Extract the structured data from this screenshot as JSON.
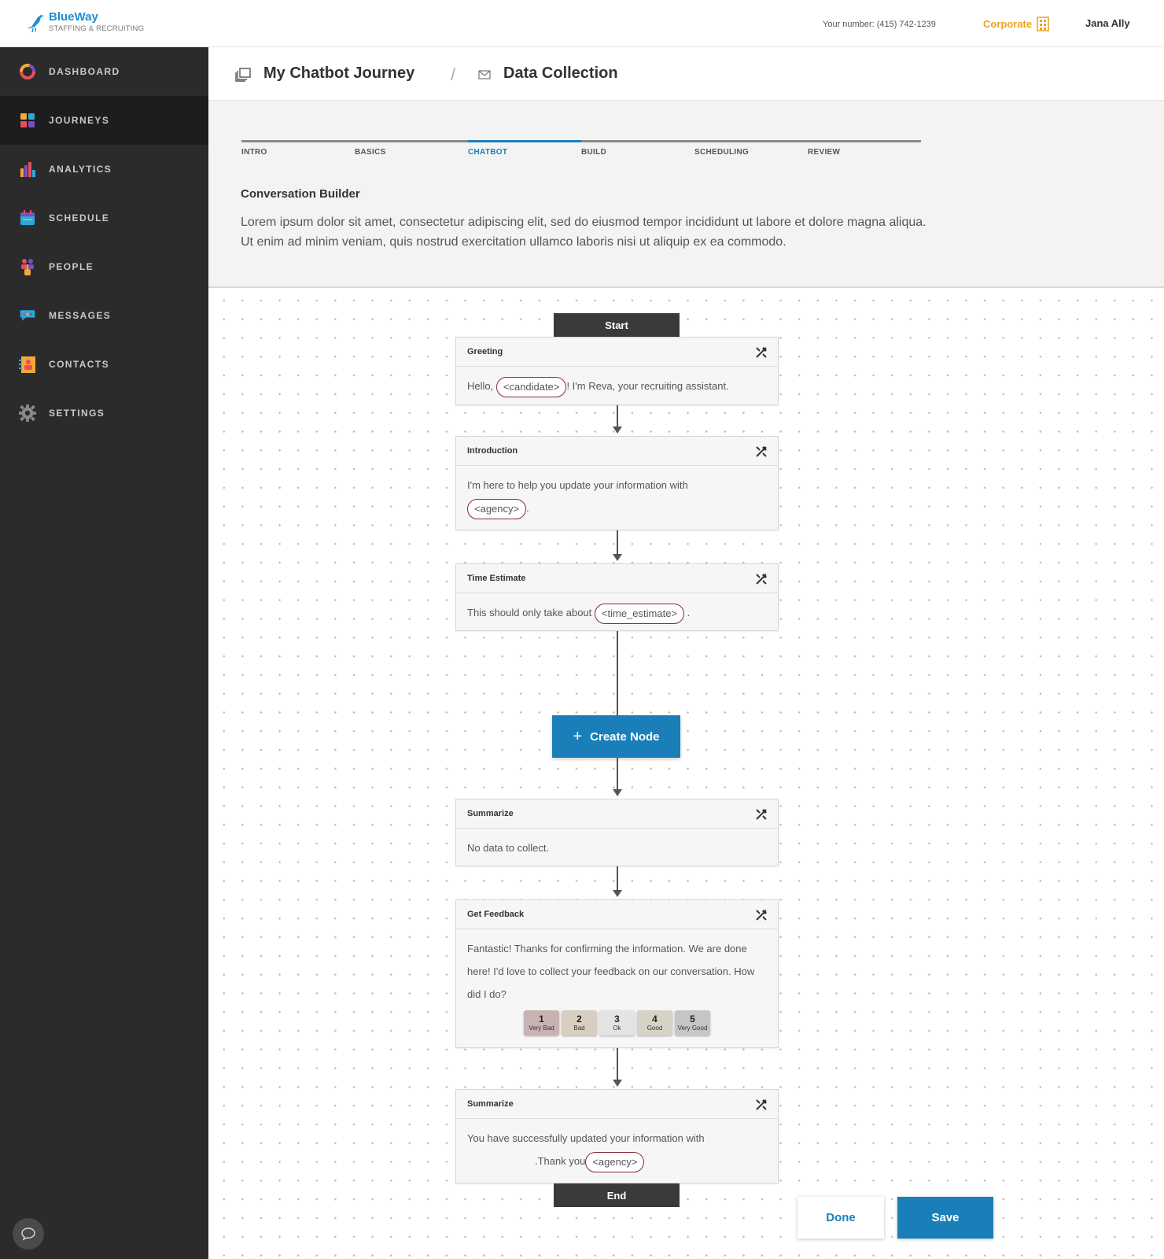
{
  "header": {
    "brand_name": "BlueWay",
    "brand_tagline": "STAFFING & RECRUITING",
    "phone": "Your number: (415) 742-1239",
    "account": "Corporate",
    "user": "Jana Ally",
    "colors": {
      "brand": "#1b8fd6",
      "account": "#f0a21c"
    }
  },
  "sidebar": {
    "items": [
      {
        "label": "DASHBOARD",
        "icon": "dashboard-ring-icon"
      },
      {
        "label": "JOURNEYS",
        "icon": "journeys-grid-icon",
        "active": true
      },
      {
        "label": "ANALYTICS",
        "icon": "analytics-bar-icon"
      },
      {
        "label": "SCHEDULE",
        "icon": "calendar-icon"
      },
      {
        "label": "PEOPLE",
        "icon": "people-icon"
      },
      {
        "label": "MESSAGES",
        "icon": "message-bubble-icon"
      },
      {
        "label": "CONTACTS",
        "icon": "contact-card-icon"
      },
      {
        "label": "SETTINGS",
        "icon": "gear-icon"
      }
    ]
  },
  "breadcrumb": {
    "journey": "My Chatbot Journey",
    "separator": "/",
    "page": "Data Collection"
  },
  "steps": [
    {
      "label": "INTRO"
    },
    {
      "label": "BASICS"
    },
    {
      "label": "CHATBOT",
      "active": true
    },
    {
      "label": "BUILD"
    },
    {
      "label": "SCHEDULING"
    },
    {
      "label": "REVIEW"
    }
  ],
  "builder": {
    "title": "Conversation Builder",
    "description": "Lorem ipsum dolor sit amet, consectetur adipiscing elit, sed do eiusmod tempor incididunt ut labore et dolore magna aliqua. Ut enim ad minim veniam, quis nostrud exercitation ullamco laboris nisi ut aliquip ex ea commodo."
  },
  "flow": {
    "start_label": "Start",
    "end_label": "End",
    "create_node_label": "Create Node",
    "nodes": [
      {
        "title": "Greeting",
        "text_before": "Hello,",
        "chip": "<candidate>",
        "text_after": "! I'm Reva, your recruiting assistant."
      },
      {
        "title": "Introduction",
        "text_before": "I'm here to help you update your information with",
        "chip": "<agency>",
        "text_after": "."
      },
      {
        "title": "Time Estimate",
        "text_before": "This should only take about",
        "chip": "<time_estimate>",
        "text_after": "."
      },
      {
        "title": "Summarize",
        "text_before": "No data to collect."
      },
      {
        "title": "Get Feedback",
        "text_before": "Fantastic! Thanks for confirming the information. We are done here! I'd love to collect your feedback on our conversation. How did I do?"
      },
      {
        "title": "Summarize",
        "text_before": "You have successfully updated your information with",
        "text_mid": ".Thank you",
        "chip": "<agency>"
      }
    ],
    "ratings": [
      {
        "num": "1",
        "label": "Very Bad",
        "color": "#c9b2b2"
      },
      {
        "num": "2",
        "label": "Bad",
        "color": "#d9cfc0"
      },
      {
        "num": "3",
        "label": "Ok",
        "color": "#e4e4e4"
      },
      {
        "num": "4",
        "label": "Good",
        "color": "#d5d3c6"
      },
      {
        "num": "5",
        "label": "Very Good",
        "color": "#c6c6c6"
      }
    ]
  },
  "actions": {
    "done_label": "Done",
    "save_label": "Save",
    "accent": "#1a7fb8"
  }
}
